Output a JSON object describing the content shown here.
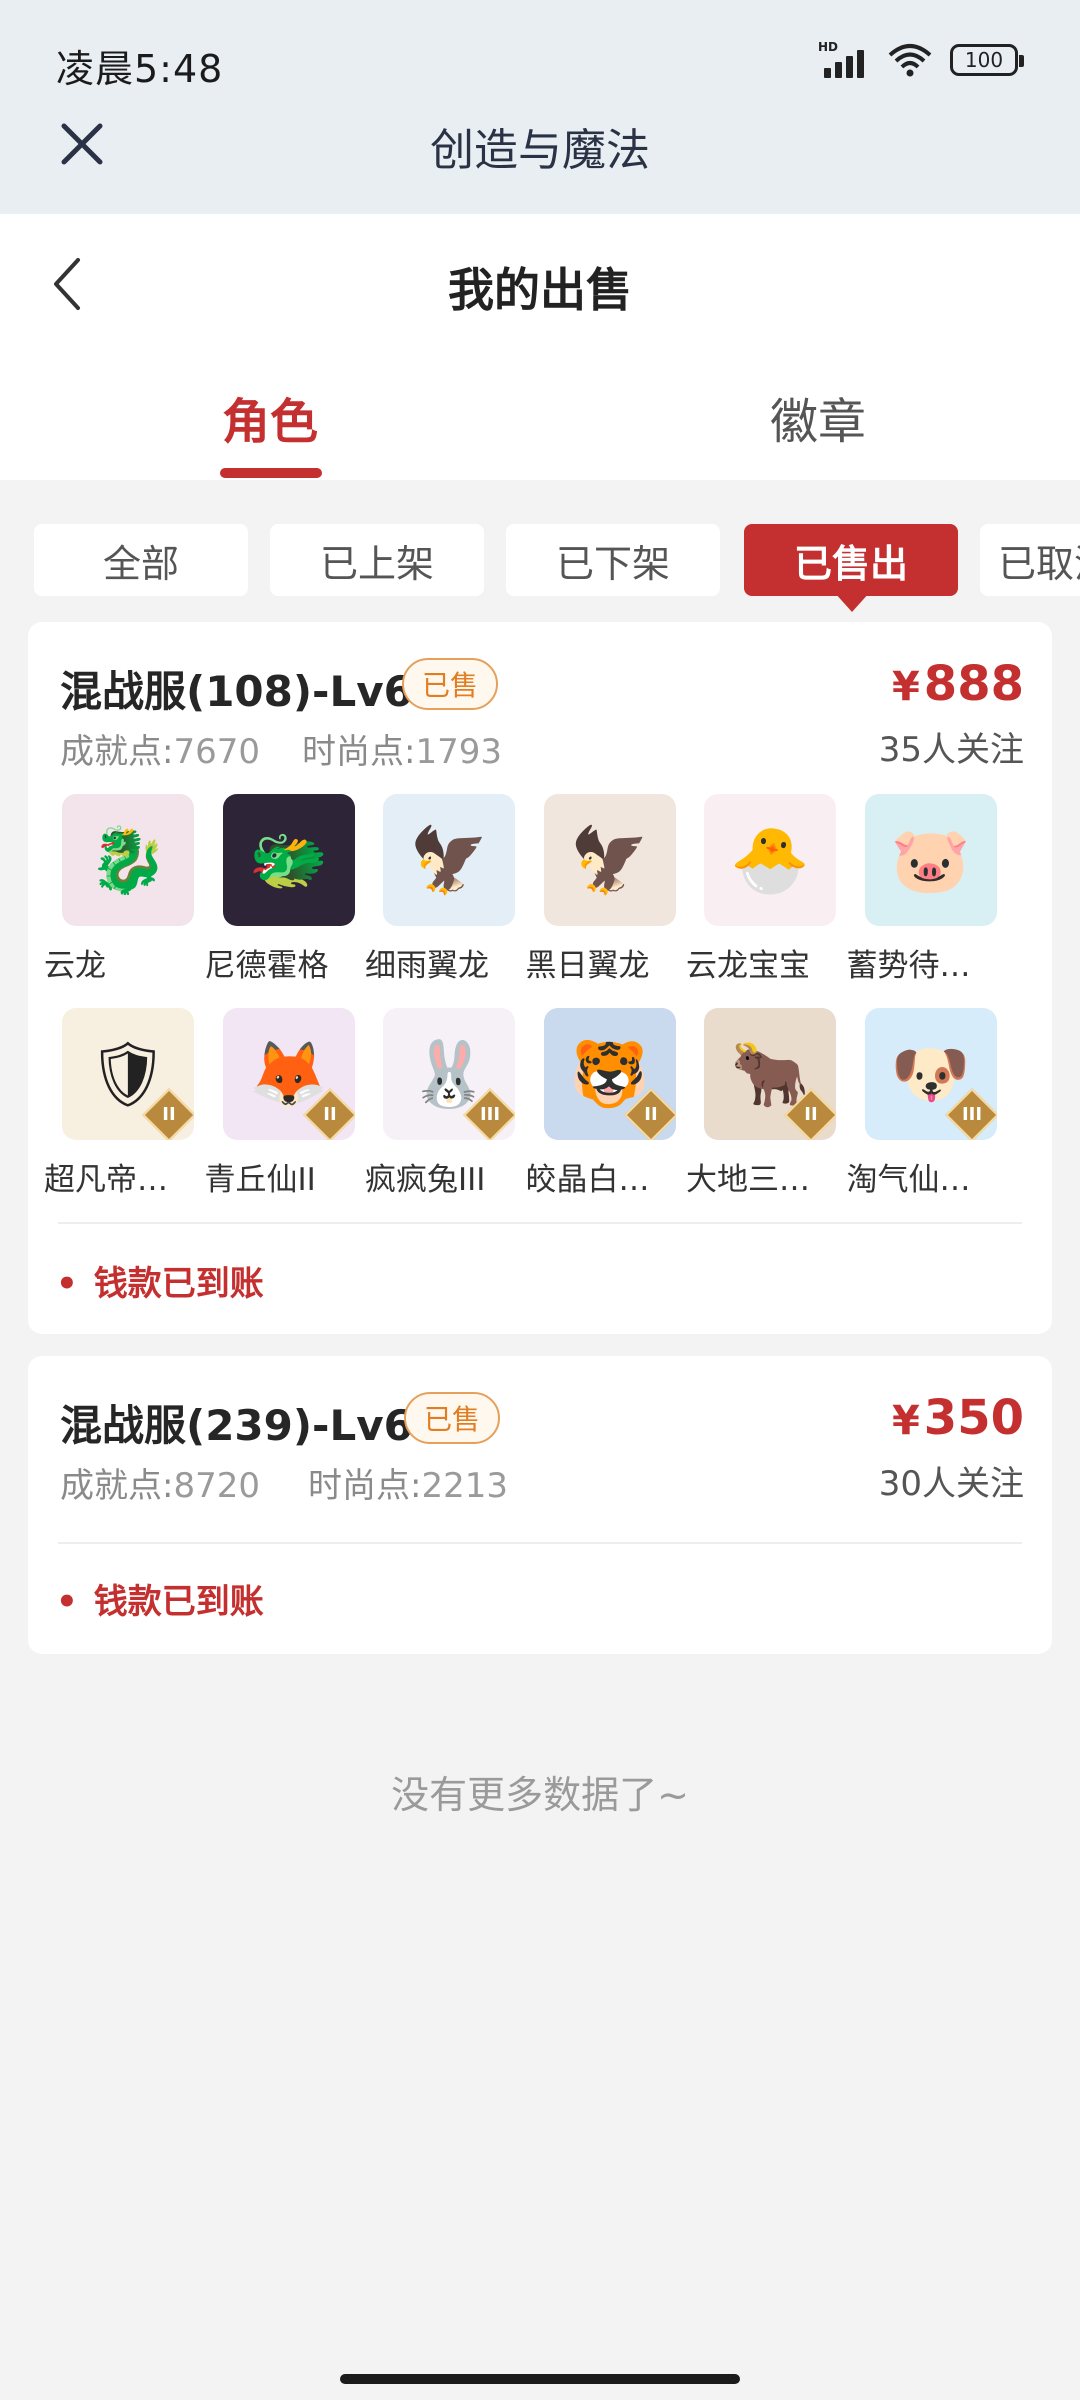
{
  "status": {
    "time": "凌晨5:48",
    "network": "HD",
    "battery": "100"
  },
  "app": {
    "title": "创造与魔法"
  },
  "page": {
    "title": "我的出售"
  },
  "tabs": [
    {
      "label": "角色",
      "active": true
    },
    {
      "label": "徽章",
      "active": false
    }
  ],
  "filters": [
    {
      "label": "全部",
      "active": false
    },
    {
      "label": "已上架",
      "active": false
    },
    {
      "label": "已下架",
      "active": false
    },
    {
      "label": "已售出",
      "active": true
    },
    {
      "label": "已取消",
      "active": false
    }
  ],
  "orders": [
    {
      "server": "混战服(108)-Lv69",
      "tag": "已售",
      "price_symbol": "¥",
      "price": "888",
      "follows": "35人关注",
      "achievement_label": "成就点:",
      "achievement_value": "7670",
      "fashion_label": "时尚点:",
      "fashion_value": "1793",
      "pets": [
        {
          "name": "云龙",
          "icon": "dragon-icon",
          "color": "#f3e4ec",
          "rank": ""
        },
        {
          "name": "尼德霍格",
          "icon": "dark-dragon-icon",
          "color": "#2d2438",
          "rank": ""
        },
        {
          "name": "细雨翼龙",
          "icon": "pterosaur-icon",
          "color": "#e4eef6",
          "rank": ""
        },
        {
          "name": "黑日翼龙",
          "icon": "pterosaur-icon",
          "color": "#f0e6de",
          "rank": ""
        },
        {
          "name": "云龙宝宝",
          "icon": "baby-dragon-icon",
          "color": "#f9eef1",
          "rank": ""
        },
        {
          "name": "蓄势待…",
          "icon": "pig-icon",
          "color": "#d8f0f3",
          "rank": ""
        },
        {
          "name": "超凡帝…",
          "icon": "armor-icon",
          "color": "#f7efe0",
          "rank": "II"
        },
        {
          "name": "青丘仙II",
          "icon": "fox-fairy-icon",
          "color": "#f2e6f5",
          "rank": "II"
        },
        {
          "name": "疯疯兔III",
          "icon": "rabbit-icon",
          "color": "#f6f1f7",
          "rank": "III"
        },
        {
          "name": "皎晶白…",
          "icon": "tiger-icon",
          "color": "#c9d9ee",
          "rank": "II"
        },
        {
          "name": "大地三…",
          "icon": "beast-icon",
          "color": "#e9dccd",
          "rank": "II"
        },
        {
          "name": "淘气仙…",
          "icon": "dog-icon",
          "color": "#d6ecfa",
          "rank": "III"
        }
      ],
      "payment_status": "钱款已到账"
    },
    {
      "server": "混战服(239)-Lv69",
      "tag": "已售",
      "price_symbol": "¥",
      "price": "350",
      "follows": "30人关注",
      "achievement_label": "成就点:",
      "achievement_value": "8720",
      "fashion_label": "时尚点:",
      "fashion_value": "2213",
      "payment_status": "钱款已到账"
    }
  ],
  "footer": {
    "no_more": "没有更多数据了~"
  },
  "colors": {
    "accent": "#c3302f",
    "tag_orange": "#e37d22",
    "background": "#f3f3f4"
  }
}
